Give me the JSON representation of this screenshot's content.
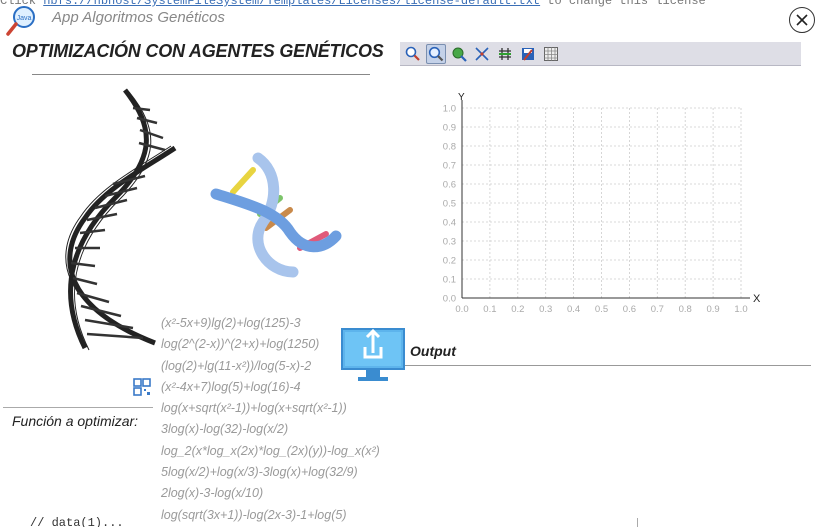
{
  "background": {
    "code_prefix": "Click",
    "code_link": "nbfs://nbhost/SystemFileSystem/Templates/Licenses/license-default.txt",
    "code_suffix": "to change this license",
    "bottom_text": "// data(1)..."
  },
  "app": {
    "title": "App Algoritmos Genéticos",
    "main_title": "OPTIMIZACIÓN CON AGENTES GENÉTICOS"
  },
  "toolbar": {
    "buttons": [
      {
        "name": "zoom-select-icon"
      },
      {
        "name": "zoom-icon",
        "active": true
      },
      {
        "name": "pan-icon"
      },
      {
        "name": "fit-icon"
      },
      {
        "name": "grid-icon"
      },
      {
        "name": "save-icon"
      },
      {
        "name": "table-icon"
      }
    ]
  },
  "chart_data": {
    "type": "scatter",
    "xlabel": "X",
    "ylabel": "Y",
    "xlim": [
      0.0,
      1.0
    ],
    "ylim": [
      0.0,
      1.0
    ],
    "xticks": [
      "0.0",
      "0.1",
      "0.2",
      "0.3",
      "0.4",
      "0.5",
      "0.6",
      "0.7",
      "0.8",
      "0.9",
      "1.0"
    ],
    "yticks": [
      "0.0",
      "0.1",
      "0.2",
      "0.3",
      "0.4",
      "0.5",
      "0.6",
      "0.7",
      "0.8",
      "0.9",
      "1.0"
    ],
    "grid": true,
    "series": []
  },
  "functions": [
    "(x²-5x+9)lg(2)+log(125)-3",
    "log(2^(2-x))^(2+x)+log(1250)",
    "(log(2)+lg(11-x²))/log(5-x)-2",
    "(x²-4x+7)log(5)+log(16)-4",
    "log(x+sqrt(x²-1))+log(x+sqrt(x²-1))",
    "3log(x)-log(32)-log(x/2)",
    "log_2(x*log_x(2x)*log_(2x)(y))-log_x(x²)",
    "5log(x/2)+log(x/3)-3log(x)+log(32/9)",
    "2log(x)-3-log(x/10)",
    "log(sqrt(3x+1))-log(2x-3)-1+log(5)"
  ],
  "labels": {
    "function_to_optimize": "Función a optimizar:",
    "output": "Output"
  },
  "colors": {
    "toolbar_bg": "#dedee6",
    "grid": "#cccccc",
    "axis": "#333333",
    "tick_label": "#aaaaaa",
    "function_text": "#9a9a9a"
  }
}
